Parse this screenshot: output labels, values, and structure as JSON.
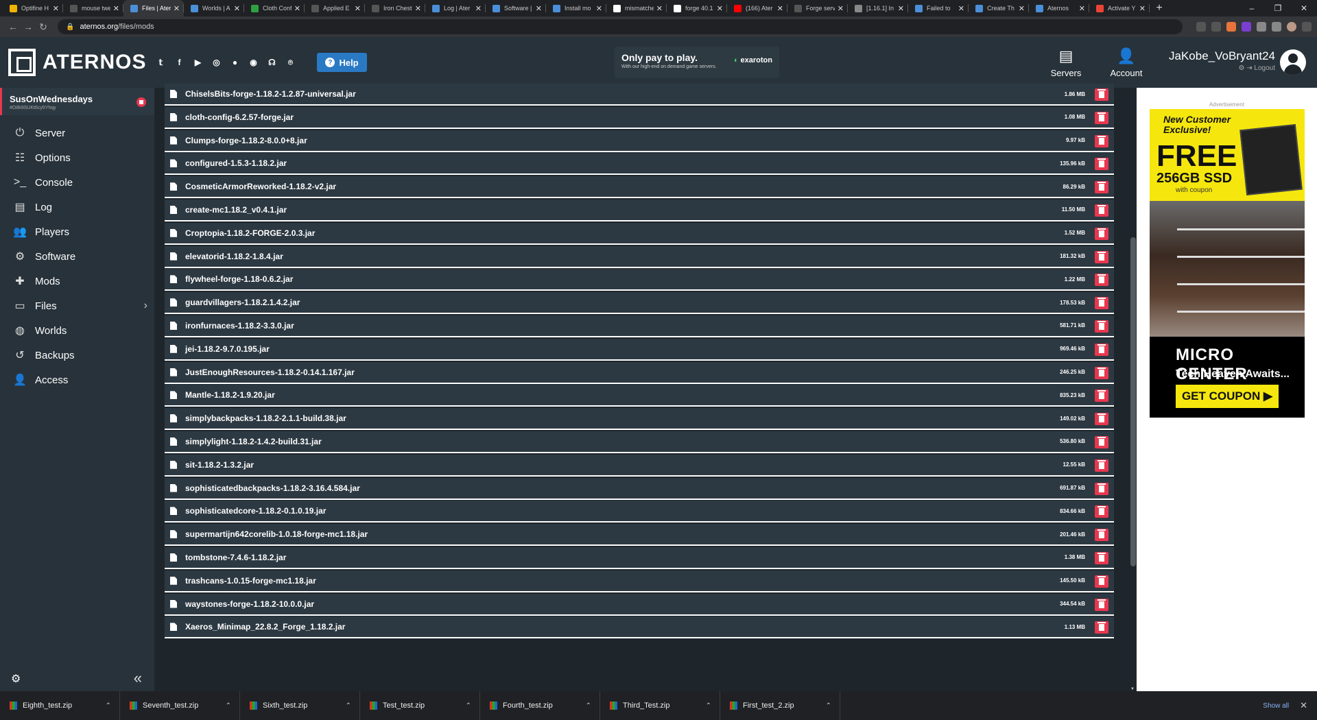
{
  "browser": {
    "tabs": [
      {
        "label": "Optifine H",
        "color": "#f0b400"
      },
      {
        "label": "mouse twe",
        "color": "#555555"
      },
      {
        "label": "Files | Ater",
        "color": "#4a8fd8",
        "active": true
      },
      {
        "label": "Worlds | A",
        "color": "#4a8fd8"
      },
      {
        "label": "Cloth Conf",
        "color": "#2ea043"
      },
      {
        "label": "Applied E",
        "color": "#555555"
      },
      {
        "label": "Iron Chest",
        "color": "#555555"
      },
      {
        "label": "Log | Ater",
        "color": "#4a8fd8"
      },
      {
        "label": "Software |",
        "color": "#4a8fd8"
      },
      {
        "label": "Install mo",
        "color": "#4a8fd8"
      },
      {
        "label": "mismatche",
        "color": "#ffffff"
      },
      {
        "label": "forge 40.1",
        "color": "#ffffff"
      },
      {
        "label": "(166) Ater",
        "color": "#ff0000"
      },
      {
        "label": "Forge serv",
        "color": "#555555"
      },
      {
        "label": "[1.16.1] In",
        "color": "#888888"
      },
      {
        "label": "Failed to",
        "color": "#4a8fd8"
      },
      {
        "label": "Create Th",
        "color": "#4a8fd8"
      },
      {
        "label": "Aternos",
        "color": "#4a8fd8"
      },
      {
        "label": "Activate Y",
        "color": "#ea4335"
      }
    ],
    "new_tab": "+",
    "url_domain": "aternos.org",
    "url_path": "/files/mods"
  },
  "header": {
    "logo_text": "ATERNOS",
    "help_label": "Help",
    "ad_title": "Only pay to play.",
    "ad_subtitle": "With our high-end on demand game servers.",
    "ad_brand": "exaroton",
    "ad_brand_sub": "by Aternos",
    "servers_label": "Servers",
    "account_label": "Account",
    "username": "JaKobe_VoBryant24",
    "logout_label": "Logout"
  },
  "sidebar": {
    "server_name": "SusOnWednesdays",
    "server_id": "#O8k9SUKt6cy5Yhqy",
    "items": [
      {
        "label": "Server",
        "icon": "power-icon",
        "glyph": "⏻"
      },
      {
        "label": "Options",
        "icon": "sliders-icon",
        "glyph": "☷"
      },
      {
        "label": "Console",
        "icon": "terminal-icon",
        "glyph": ">_"
      },
      {
        "label": "Log",
        "icon": "document-icon",
        "glyph": "▤"
      },
      {
        "label": "Players",
        "icon": "users-icon",
        "glyph": "👥"
      },
      {
        "label": "Software",
        "icon": "gears-icon",
        "glyph": "⚙"
      },
      {
        "label": "Mods",
        "icon": "puzzle-icon",
        "glyph": "✚"
      },
      {
        "label": "Files",
        "icon": "folder-icon",
        "glyph": "▭",
        "chevron": "›"
      },
      {
        "label": "Worlds",
        "icon": "globe-icon",
        "glyph": "◍"
      },
      {
        "label": "Backups",
        "icon": "history-icon",
        "glyph": "↺"
      },
      {
        "label": "Access",
        "icon": "user-lock-icon",
        "glyph": "👤"
      }
    ]
  },
  "files": [
    {
      "name": "ChiselsBits-forge-1.18.2-1.2.87-universal.jar",
      "size": "1.86 MB"
    },
    {
      "name": "cloth-config-6.2.57-forge.jar",
      "size": "1.08 MB"
    },
    {
      "name": "Clumps-forge-1.18.2-8.0.0+8.jar",
      "size": "9.97 kB"
    },
    {
      "name": "configured-1.5.3-1.18.2.jar",
      "size": "135.96 kB"
    },
    {
      "name": "CosmeticArmorReworked-1.18.2-v2.jar",
      "size": "86.29 kB"
    },
    {
      "name": "create-mc1.18.2_v0.4.1.jar",
      "size": "11.50 MB"
    },
    {
      "name": "Croptopia-1.18.2-FORGE-2.0.3.jar",
      "size": "1.52 MB"
    },
    {
      "name": "elevatorid-1.18.2-1.8.4.jar",
      "size": "181.32 kB"
    },
    {
      "name": "flywheel-forge-1.18-0.6.2.jar",
      "size": "1.22 MB"
    },
    {
      "name": "guardvillagers-1.18.2.1.4.2.jar",
      "size": "178.53 kB"
    },
    {
      "name": "ironfurnaces-1.18.2-3.3.0.jar",
      "size": "581.71 kB"
    },
    {
      "name": "jei-1.18.2-9.7.0.195.jar",
      "size": "969.46 kB"
    },
    {
      "name": "JustEnoughResources-1.18.2-0.14.1.167.jar",
      "size": "246.25 kB"
    },
    {
      "name": "Mantle-1.18.2-1.9.20.jar",
      "size": "835.23 kB"
    },
    {
      "name": "simplybackpacks-1.18.2-2.1.1-build.38.jar",
      "size": "149.02 kB"
    },
    {
      "name": "simplylight-1.18.2-1.4.2-build.31.jar",
      "size": "536.80 kB"
    },
    {
      "name": "sit-1.18.2-1.3.2.jar",
      "size": "12.55 kB"
    },
    {
      "name": "sophisticatedbackpacks-1.18.2-3.16.4.584.jar",
      "size": "691.87 kB"
    },
    {
      "name": "sophisticatedcore-1.18.2-0.1.0.19.jar",
      "size": "834.66 kB"
    },
    {
      "name": "supermartijn642corelib-1.0.18-forge-mc1.18.jar",
      "size": "201.46 kB"
    },
    {
      "name": "tombstone-7.4.6-1.18.2.jar",
      "size": "1.38 MB"
    },
    {
      "name": "trashcans-1.0.15-forge-mc1.18.jar",
      "size": "145.50 kB"
    },
    {
      "name": "waystones-forge-1.18.2-10.0.0.jar",
      "size": "344.54 kB"
    },
    {
      "name": "Xaeros_Minimap_22.8.2_Forge_1.18.2.jar",
      "size": "1.13 MB"
    }
  ],
  "side_ad": {
    "label": "Advertisement",
    "line1": "New Customer",
    "line2": "Exclusive!",
    "free": "FREE",
    "ssd": "256GB SSD",
    "with_coupon": "with coupon",
    "brand": "MICRO CENTER",
    "tagline": "Tech Heaven Awaits...",
    "cta": "GET COUPON ▶"
  },
  "downloads": {
    "items": [
      "Eighth_test.zip",
      "Seventh_test.zip",
      "Sixth_test.zip",
      "Test_test.zip",
      "Fourth_test.zip",
      "Third_Test.zip",
      "First_test_2.zip"
    ],
    "show_all": "Show all"
  },
  "colors": {
    "accent_red": "#e8384f",
    "help_blue": "#2a79c4",
    "panel": "#2d3942",
    "background": "#1e262c"
  }
}
